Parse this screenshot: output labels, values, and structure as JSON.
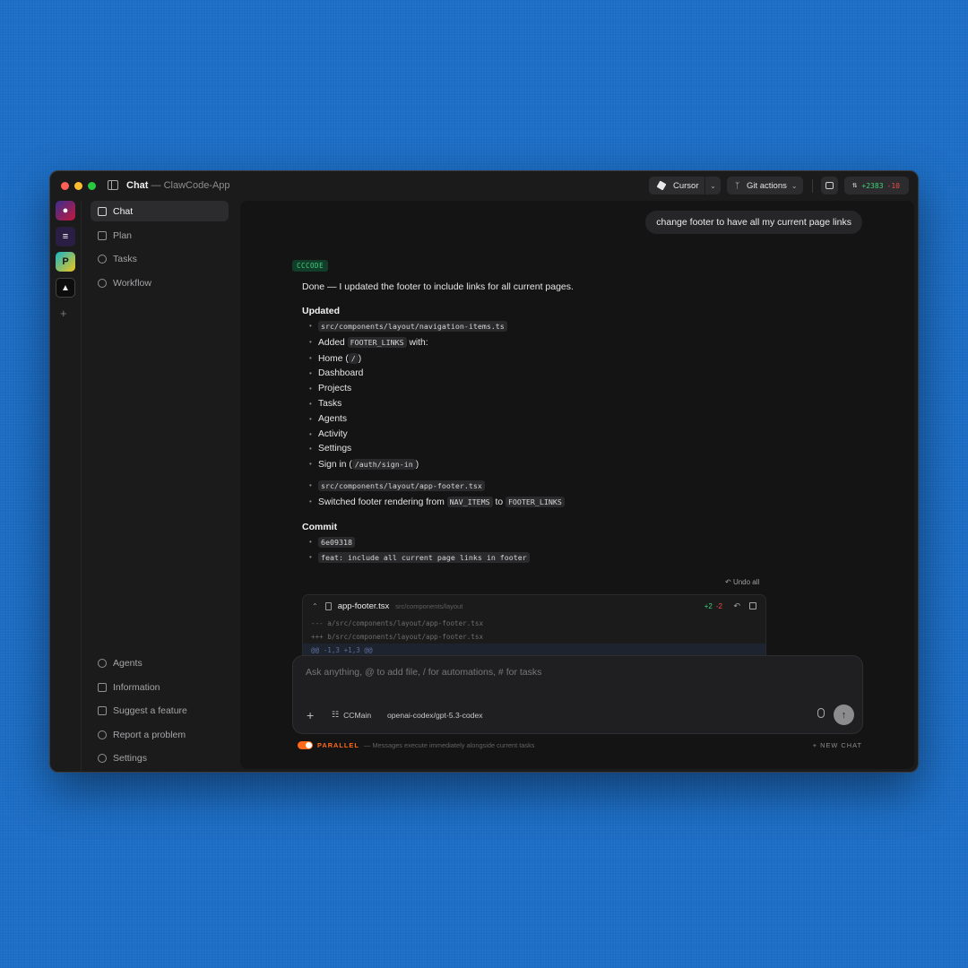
{
  "window": {
    "title": "Chat",
    "title_suffix": " — ClawCode-App"
  },
  "toolbar": {
    "cursor_label": "Cursor",
    "git_label": "Git actions",
    "diff_plus": "+2383",
    "diff_minus": "-10"
  },
  "rail": {
    "apps": [
      "app-1",
      "app-2",
      "app-3",
      "app-4"
    ],
    "add_label": "+"
  },
  "sidebar": {
    "top_items": [
      {
        "label": "Chat",
        "icon": "edit-icon",
        "active": true
      },
      {
        "label": "Plan",
        "icon": "calendar-icon"
      },
      {
        "label": "Tasks",
        "icon": "bell-icon"
      },
      {
        "label": "Workflow",
        "icon": "workflow-icon"
      }
    ],
    "bottom_items": [
      {
        "label": "Agents",
        "icon": "agent-icon"
      },
      {
        "label": "Information",
        "icon": "book-icon"
      },
      {
        "label": "Suggest a feature",
        "icon": "gift-icon"
      },
      {
        "label": "Report a problem",
        "icon": "bug-icon"
      },
      {
        "label": "Settings",
        "icon": "gear-icon"
      }
    ]
  },
  "chat": {
    "user_message": "change footer to have all my current page links",
    "agent_tag": "CCCODE",
    "intro": "Done — I updated the footer to include links for all current pages.",
    "updated_heading": "Updated",
    "file1": "src/components/layout/navigation-items.ts",
    "added_prefix": "Added ",
    "added_code": "FOOTER_LINKS",
    "added_suffix": " with:",
    "pages": [
      "Dashboard",
      "Projects",
      "Tasks",
      "Agents",
      "Activity",
      "Settings"
    ],
    "home_label": "Home (",
    "home_code": "/",
    "home_close": ")",
    "signin_label": "Sign in (",
    "signin_code": "/auth/sign-in",
    "signin_close": ")",
    "file2": "src/components/layout/app-footer.tsx",
    "switched_prefix": "Switched footer rendering from ",
    "switched_from": "NAV_ITEMS",
    "switched_mid": " to ",
    "switched_to": "FOOTER_LINKS",
    "commit_heading": "Commit",
    "commit_hash": "6e09318",
    "commit_message": "feat: include all current page links in footer"
  },
  "diff": {
    "undo_all": "Undo all",
    "file_name": "app-footer.tsx",
    "file_path": "src/components/layout",
    "plus": "+2",
    "minus": "-2",
    "lines": [
      "--- a/src/components/layout/app-footer.tsx",
      "+++ b/src/components/layout/app-footer.tsx",
      "@@ -1,3 +1,3 @@"
    ]
  },
  "composer": {
    "placeholder": "Ask anything, @ to add file, / for automations, # for tasks",
    "value": "",
    "agent": "CCMain",
    "model": "openai-codex/gpt-5.3-codex"
  },
  "footer": {
    "parallel_label": "PARALLEL",
    "parallel_desc": "— Messages execute immediately alongside current tasks",
    "new_chat": "+ NEW CHAT"
  },
  "colors": {
    "background": "#1a6cc4",
    "accent_orange": "#ff6a1a",
    "diff_green": "#3ed27a",
    "diff_red": "#f04a4a"
  }
}
